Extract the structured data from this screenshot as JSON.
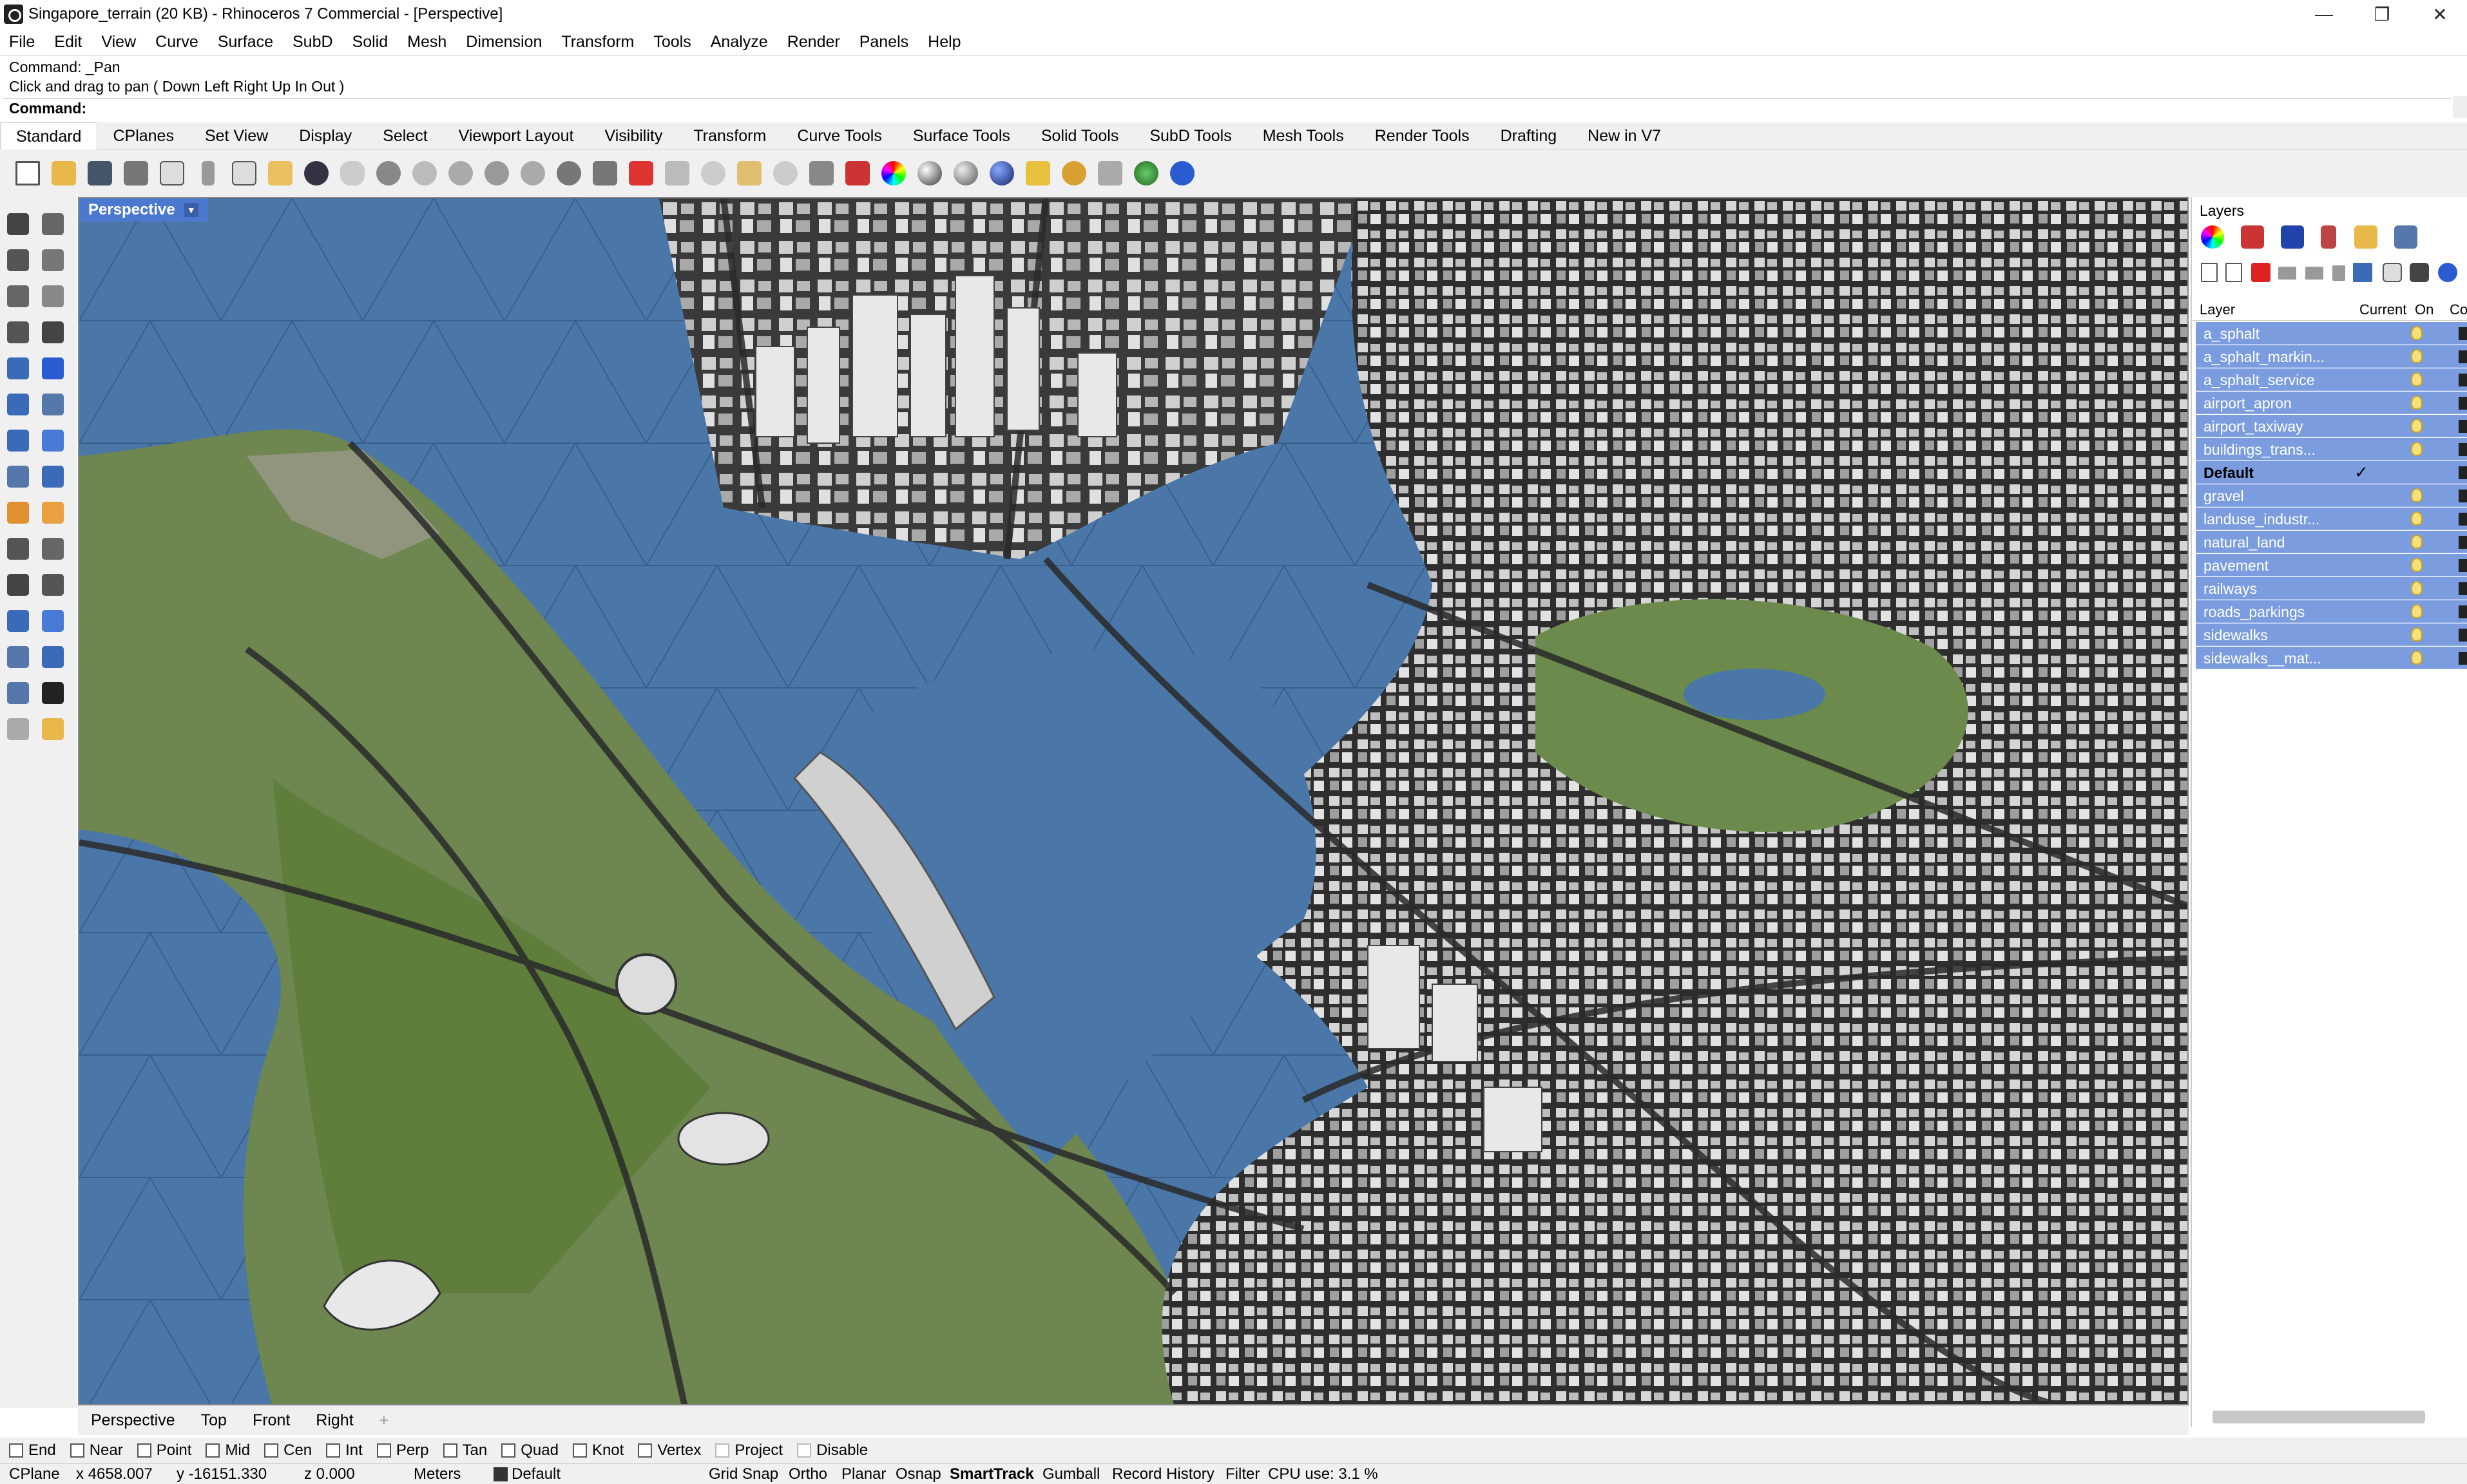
{
  "window": {
    "title": "Singapore_terrain (20 KB) - Rhinoceros 7 Commercial - [Perspective]",
    "controls": {
      "minimize": "—",
      "restore": "❐",
      "close": "✕"
    }
  },
  "menu": [
    "File",
    "Edit",
    "View",
    "Curve",
    "Surface",
    "SubD",
    "Solid",
    "Mesh",
    "Dimension",
    "Transform",
    "Tools",
    "Analyze",
    "Render",
    "Panels",
    "Help"
  ],
  "command_history": {
    "line1": "Command: _Pan",
    "line2": "Click and drag to pan ( Down  Left  Right  Up  In  Out )",
    "prompt": "Command:"
  },
  "toolbar_tabs": [
    "Standard",
    "CPlanes",
    "Set View",
    "Display",
    "Select",
    "Viewport Layout",
    "Visibility",
    "Transform",
    "Curve Tools",
    "Surface Tools",
    "Solid Tools",
    "SubD Tools",
    "Mesh Tools",
    "Render Tools",
    "Drafting",
    "New in V7"
  ],
  "active_tab": "Standard",
  "viewport": {
    "label": "Perspective",
    "dropdown": "▼"
  },
  "layers": {
    "title": "Layers",
    "columns": {
      "layer": "Layer",
      "current": "Current",
      "on": "On",
      "color": "Co"
    },
    "rows": [
      {
        "name": "a_sphalt"
      },
      {
        "name": "a_sphalt_markin..."
      },
      {
        "name": "a_sphalt_service"
      },
      {
        "name": "airport_apron"
      },
      {
        "name": "airport_taxiway"
      },
      {
        "name": "buildings_trans..."
      },
      {
        "name": "Default",
        "current": "✓"
      },
      {
        "name": "gravel"
      },
      {
        "name": "landuse_industr..."
      },
      {
        "name": "natural_land"
      },
      {
        "name": "pavement"
      },
      {
        "name": "railways"
      },
      {
        "name": "roads_parkings"
      },
      {
        "name": "sidewalks"
      },
      {
        "name": "sidewalks__mat..."
      }
    ]
  },
  "viewport_tabs": [
    "Perspective",
    "Top",
    "Front",
    "Right"
  ],
  "viewport_tab_add": "+",
  "osnaps": [
    {
      "label": "End",
      "checked": false
    },
    {
      "label": "Near",
      "checked": false
    },
    {
      "label": "Point",
      "checked": false
    },
    {
      "label": "Mid",
      "checked": false
    },
    {
      "label": "Cen",
      "checked": false
    },
    {
      "label": "Int",
      "checked": false
    },
    {
      "label": "Perp",
      "checked": false
    },
    {
      "label": "Tan",
      "checked": false
    },
    {
      "label": "Quad",
      "checked": false
    },
    {
      "label": "Knot",
      "checked": false
    },
    {
      "label": "Vertex",
      "checked": false
    },
    {
      "label": "Project",
      "checked": false
    },
    {
      "label": "Disable",
      "checked": false
    }
  ],
  "status": {
    "cplane": "CPlane",
    "x": "x 4658.007",
    "y": "y -16151.330",
    "z": "z 0.000",
    "units": "Meters",
    "layer": "Default",
    "grid_snap": "Grid Snap",
    "ortho": "Ortho",
    "planar": "Planar",
    "osnap": "Osnap",
    "smarttrack": "SmartTrack",
    "gumball": "Gumball",
    "record_history": "Record History",
    "filter": "Filter",
    "cpu": "CPU use: 3.1 %"
  },
  "colors": {
    "water": "#4a77a8",
    "land": "#6f8a4a",
    "viewport_label": "#4c79d0",
    "layer_row": "#7b9de0"
  }
}
